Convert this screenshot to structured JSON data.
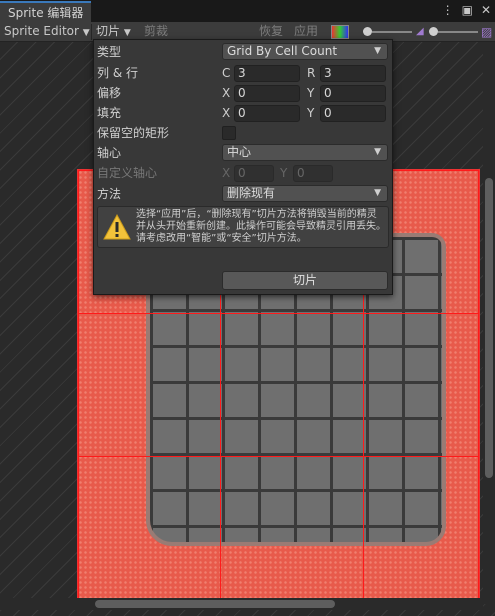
{
  "window": {
    "tab_title": "Sprite 编辑器"
  },
  "toolbar": {
    "mode_dropdown": "Sprite Editor",
    "slice_menu": "切片",
    "trim_button": "剪裁",
    "revert_button": "恢复",
    "apply_button": "应用"
  },
  "slice_panel": {
    "type": {
      "label": "类型",
      "value": "Grid By Cell Count"
    },
    "column_row": {
      "label": "列 & 行",
      "x_axis": "C",
      "x_value": "3",
      "y_axis": "R",
      "y_value": "3"
    },
    "offset": {
      "label": "偏移",
      "x_axis": "X",
      "x_value": "0",
      "y_axis": "Y",
      "y_value": "0"
    },
    "padding": {
      "label": "填充",
      "x_axis": "X",
      "x_value": "0",
      "y_axis": "Y",
      "y_value": "0"
    },
    "keep_empty": {
      "label": "保留空的矩形",
      "checked": false
    },
    "pivot": {
      "label": "轴心",
      "value": "中心"
    },
    "custom_pivot": {
      "label": "自定义轴心",
      "x_axis": "X",
      "x_value": "0",
      "y_axis": "Y",
      "y_value": "0"
    },
    "method": {
      "label": "方法",
      "value": "删除现有"
    },
    "help_text": "选择“应用”后，“删除现有”切片方法将销毁当前的精灵并从头开始重新创建。此操作可能会导致精灵引用丢失。请考虑改用“智能”或“安全”切片方法。",
    "slice_button": "切片"
  },
  "colors": {
    "accent": "#3a79bb",
    "grid_line": "#ff1a1a",
    "sprite_bg": "#e85a4b",
    "warning": "#f2c23a"
  }
}
